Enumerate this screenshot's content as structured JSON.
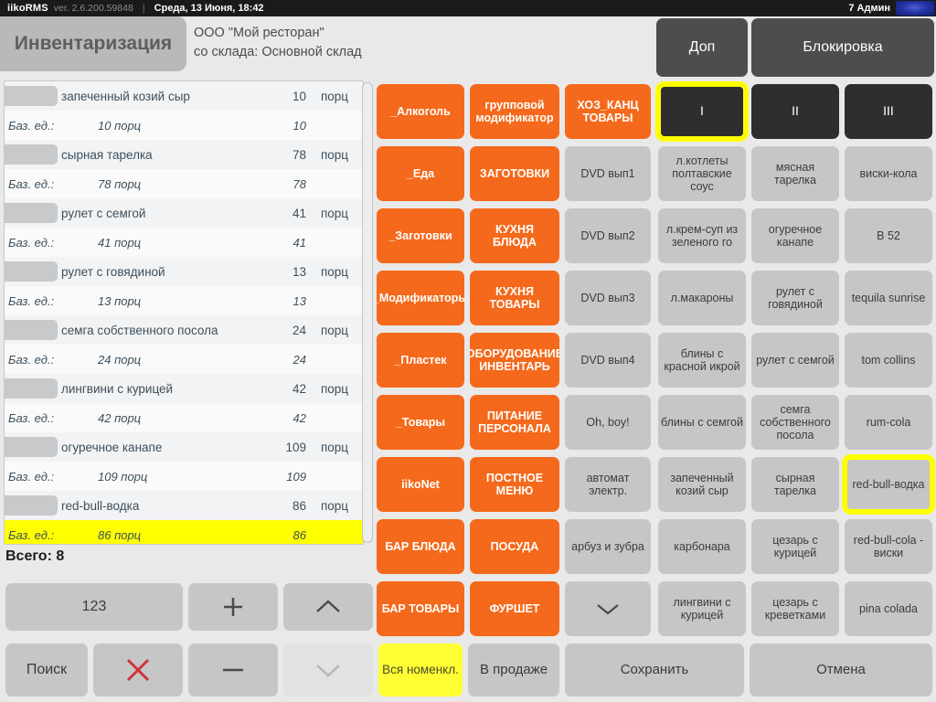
{
  "titlebar": {
    "brand": "iikoRMS",
    "version": "ver. 2.6.200.59848",
    "separator": "|",
    "datetime": "Среда, 13 Июня, 18:42",
    "user": "7 Админ"
  },
  "header": {
    "tab_label": "Инвентаризация",
    "org_line1": "ООО \"Мой ресторан\"",
    "org_line2": "со склада: Основной склад",
    "dop_label": "Доп",
    "block_label": "Блокировка"
  },
  "list": {
    "base_label": "Баз. ед.:",
    "unit": "порц",
    "total_label": "Всего: 8",
    "rows": [
      {
        "name": "запеченный козий сыр",
        "qty": "10",
        "unit": "порц",
        "base": "10 порц",
        "base_qty": "10",
        "highlight": false
      },
      {
        "name": "сырная тарелка",
        "qty": "78",
        "unit": "порц",
        "base": "78 порц",
        "base_qty": "78",
        "highlight": false
      },
      {
        "name": "рулет с семгой",
        "qty": "41",
        "unit": "порц",
        "base": "41 порц",
        "base_qty": "41",
        "highlight": false
      },
      {
        "name": "рулет с говядиной",
        "qty": "13",
        "unit": "порц",
        "base": "13 порц",
        "base_qty": "13",
        "highlight": false
      },
      {
        "name": "семга собственного посола",
        "qty": "24",
        "unit": "порц",
        "base": "24 порц",
        "base_qty": "24",
        "highlight": false
      },
      {
        "name": "лингвини с курицей",
        "qty": "42",
        "unit": "порц",
        "base": "42 порц",
        "base_qty": "42",
        "highlight": false
      },
      {
        "name": "огуречное канапе",
        "qty": "109",
        "unit": "порц",
        "base": "109 порц",
        "base_qty": "109",
        "highlight": false
      },
      {
        "name": "red-bull-водка",
        "qty": "86",
        "unit": "порц",
        "base": "86 порц",
        "base_qty": "86",
        "highlight": true
      }
    ]
  },
  "keypad": {
    "numeric_label": "123",
    "plus_label": "+",
    "minus_label": "−",
    "search_label": "Поиск",
    "clear_icon": "red-x-icon",
    "up_icon": "chevron-up-icon",
    "down_icon": "chevron-down-icon"
  },
  "grid": {
    "columns": [
      {
        "name": "categories-orange-1",
        "buttons": [
          {
            "label": "_Алкоголь",
            "style": "orange"
          },
          {
            "label": "_Еда",
            "style": "orange"
          },
          {
            "label": "_Заготовки",
            "style": "orange"
          },
          {
            "label": "_Модификаторы",
            "style": "orange"
          },
          {
            "label": "_Пластек",
            "style": "orange"
          },
          {
            "label": "_Товары",
            "style": "orange"
          },
          {
            "label": "iikoNet",
            "style": "orange"
          },
          {
            "label": "БАР БЛЮДА",
            "style": "orange"
          },
          {
            "label": "БАР ТОВАРЫ",
            "style": "orange"
          }
        ]
      },
      {
        "name": "categories-orange-2",
        "buttons": [
          {
            "label": "групповой модификатор",
            "style": "orange"
          },
          {
            "label": "ЗАГОТОВКИ",
            "style": "orange"
          },
          {
            "label": "КУХНЯ БЛЮДА",
            "style": "orange"
          },
          {
            "label": "КУХНЯ ТОВАРЫ",
            "style": "orange"
          },
          {
            "label": "ОБОРУДОВАНИЕ ИНВЕНТАРЬ",
            "style": "orange"
          },
          {
            "label": "ПИТАНИЕ ПЕРСОНАЛА",
            "style": "orange"
          },
          {
            "label": "ПОСТНОЕ МЕНЮ",
            "style": "orange"
          },
          {
            "label": "ПОСУДА",
            "style": "orange"
          },
          {
            "label": "ФУРШЕТ",
            "style": "orange"
          }
        ]
      },
      {
        "name": "items-column-1",
        "buttons": [
          {
            "label": "ХОЗ_КАНЦ ТОВАРЫ",
            "style": "orange"
          },
          {
            "label": "DVD вып1",
            "style": "gray"
          },
          {
            "label": "DVD вып2",
            "style": "gray"
          },
          {
            "label": "DVD вып3",
            "style": "gray"
          },
          {
            "label": "DVD вып4",
            "style": "gray"
          },
          {
            "label": "Oh, boy!",
            "style": "gray"
          },
          {
            "label": "автомат электр.",
            "style": "gray"
          },
          {
            "label": "арбуз и зубра",
            "style": "gray"
          },
          {
            "label": "",
            "style": "gray",
            "icon": "chevron-down-icon"
          }
        ]
      },
      {
        "name": "items-column-2",
        "buttons": [
          {
            "label": "I",
            "style": "dark",
            "selected": true
          },
          {
            "label": "л.котлеты полтавские соус",
            "style": "gray"
          },
          {
            "label": "л.крем-суп из зеленого го",
            "style": "gray"
          },
          {
            "label": "л.макароны",
            "style": "gray"
          },
          {
            "label": "блины с красной икрой",
            "style": "gray"
          },
          {
            "label": "блины с семгой",
            "style": "gray"
          },
          {
            "label": "запеченный козий сыр",
            "style": "gray"
          },
          {
            "label": "карбонара",
            "style": "gray"
          },
          {
            "label": "лингвини с курицей",
            "style": "gray"
          }
        ]
      },
      {
        "name": "items-column-3",
        "buttons": [
          {
            "label": "II",
            "style": "dark"
          },
          {
            "label": "мясная тарелка",
            "style": "gray"
          },
          {
            "label": "огуречное канапе",
            "style": "gray"
          },
          {
            "label": "рулет с говядиной",
            "style": "gray"
          },
          {
            "label": "рулет с семгой",
            "style": "gray"
          },
          {
            "label": "семга собственного посола",
            "style": "gray"
          },
          {
            "label": "сырная тарелка",
            "style": "gray"
          },
          {
            "label": "цезарь с курицей",
            "style": "gray"
          },
          {
            "label": "цезарь с креветками",
            "style": "gray"
          }
        ]
      },
      {
        "name": "items-column-4",
        "buttons": [
          {
            "label": "III",
            "style": "dark"
          },
          {
            "label": "виски-кола",
            "style": "gray"
          },
          {
            "label": "B 52",
            "style": "gray"
          },
          {
            "label": "tequila sunrise",
            "style": "gray"
          },
          {
            "label": "tom collins",
            "style": "gray"
          },
          {
            "label": "rum-cola",
            "style": "gray"
          },
          {
            "label": "red-bull-водка",
            "style": "gray",
            "selected": true
          },
          {
            "label": "red-bull-cola - виски",
            "style": "gray"
          },
          {
            "label": "pina colada",
            "style": "gray"
          }
        ]
      }
    ]
  },
  "bottom": {
    "all_items_label": "Вся номенкл.",
    "on_sale_label": "В продаже",
    "save_label": "Сохранить",
    "cancel_label": "Отмена"
  },
  "colors": {
    "orange": "#f4691b",
    "gray_button": "#c6c6c6",
    "dark_button": "#2e2e2e",
    "highlight_yellow": "#ffff00",
    "titlebar": "#1a1a1a",
    "background": "#e9e9e9"
  }
}
